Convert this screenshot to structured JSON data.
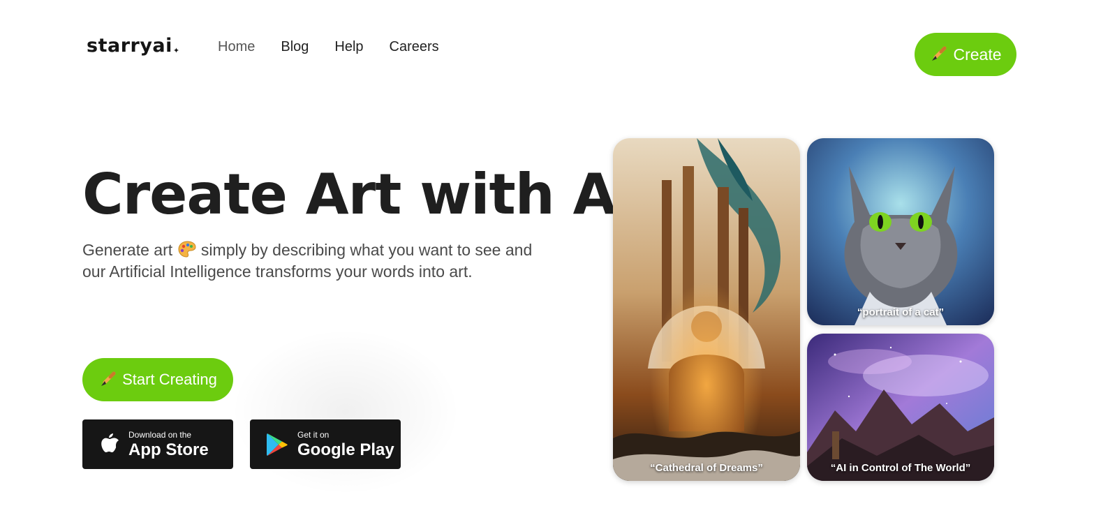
{
  "brand": {
    "logo": "starryai",
    "logo_star": "✦"
  },
  "nav": {
    "items": [
      "Home",
      "Blog",
      "Help",
      "Careers"
    ],
    "active": "Home"
  },
  "header": {
    "create_label": "Create"
  },
  "hero": {
    "title": "Create Art with AI",
    "subtitle_part1": "Generate art",
    "subtitle_part2": "simply by describing what you want to see and our Artificial Intelligence transforms your words into art.",
    "start_label": "Start Creating"
  },
  "stores": {
    "app_small": "Download on the",
    "app_big": "App Store",
    "play_small": "Get it on",
    "play_big": "Google Play"
  },
  "gallery": {
    "cathedral_caption": "“Cathedral of Dreams”",
    "cat_caption": "“portrait of a cat”",
    "space_caption": "“AI in Control of The World”"
  },
  "colors": {
    "accent": "#6ccc0f",
    "store_bg": "#161616",
    "text": "#1f1f1f"
  }
}
